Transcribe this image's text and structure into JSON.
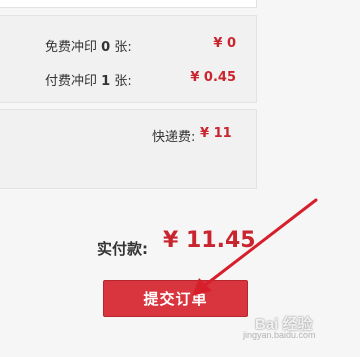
{
  "summary": {
    "free_print": {
      "label": "免费冲印",
      "count": "0",
      "unit": "张:",
      "price": "¥ 0"
    },
    "paid_print": {
      "label": "付费冲印",
      "count": "1",
      "unit": "张:",
      "price": "¥ 0.45"
    }
  },
  "shipping": {
    "label": "快递费:",
    "price": "¥ 11"
  },
  "total": {
    "label": "实付款:",
    "value": "¥ 11.45"
  },
  "submit": {
    "label": "提交订单"
  },
  "watermark": {
    "text": "Bai 经验",
    "sub": "jingyan.baidu.com"
  },
  "colors": {
    "accent": "#c8252f",
    "button": "#d9353e",
    "annotation_arrow": "#d71f2b"
  }
}
